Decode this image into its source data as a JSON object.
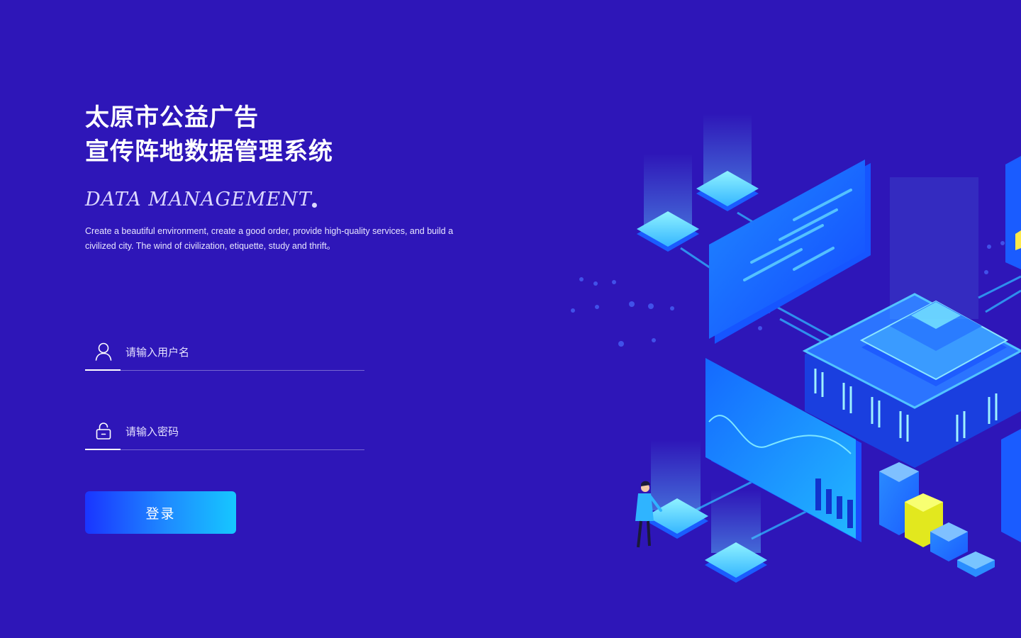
{
  "header": {
    "title_line1": "太原市公益广告",
    "title_line2": "宣传阵地数据管理系统",
    "subtitle_en": "DATA MANAGEMENT",
    "description": "Create a beautiful environment, create a good order, provide high-quality services, and build a civilized city. The wind of civilization, etiquette, study and thrift。"
  },
  "login": {
    "username_placeholder": "请输入用户名",
    "username_value": "",
    "password_placeholder": "请输入密码",
    "password_value": "",
    "submit_label": "登录"
  },
  "icons": {
    "username": "user-icon",
    "password": "lock-icon"
  },
  "colors": {
    "background": "#2e16b8",
    "button_start": "#1a35ff",
    "button_end": "#16c7ff",
    "accent_cyan": "#3fd6ff"
  }
}
